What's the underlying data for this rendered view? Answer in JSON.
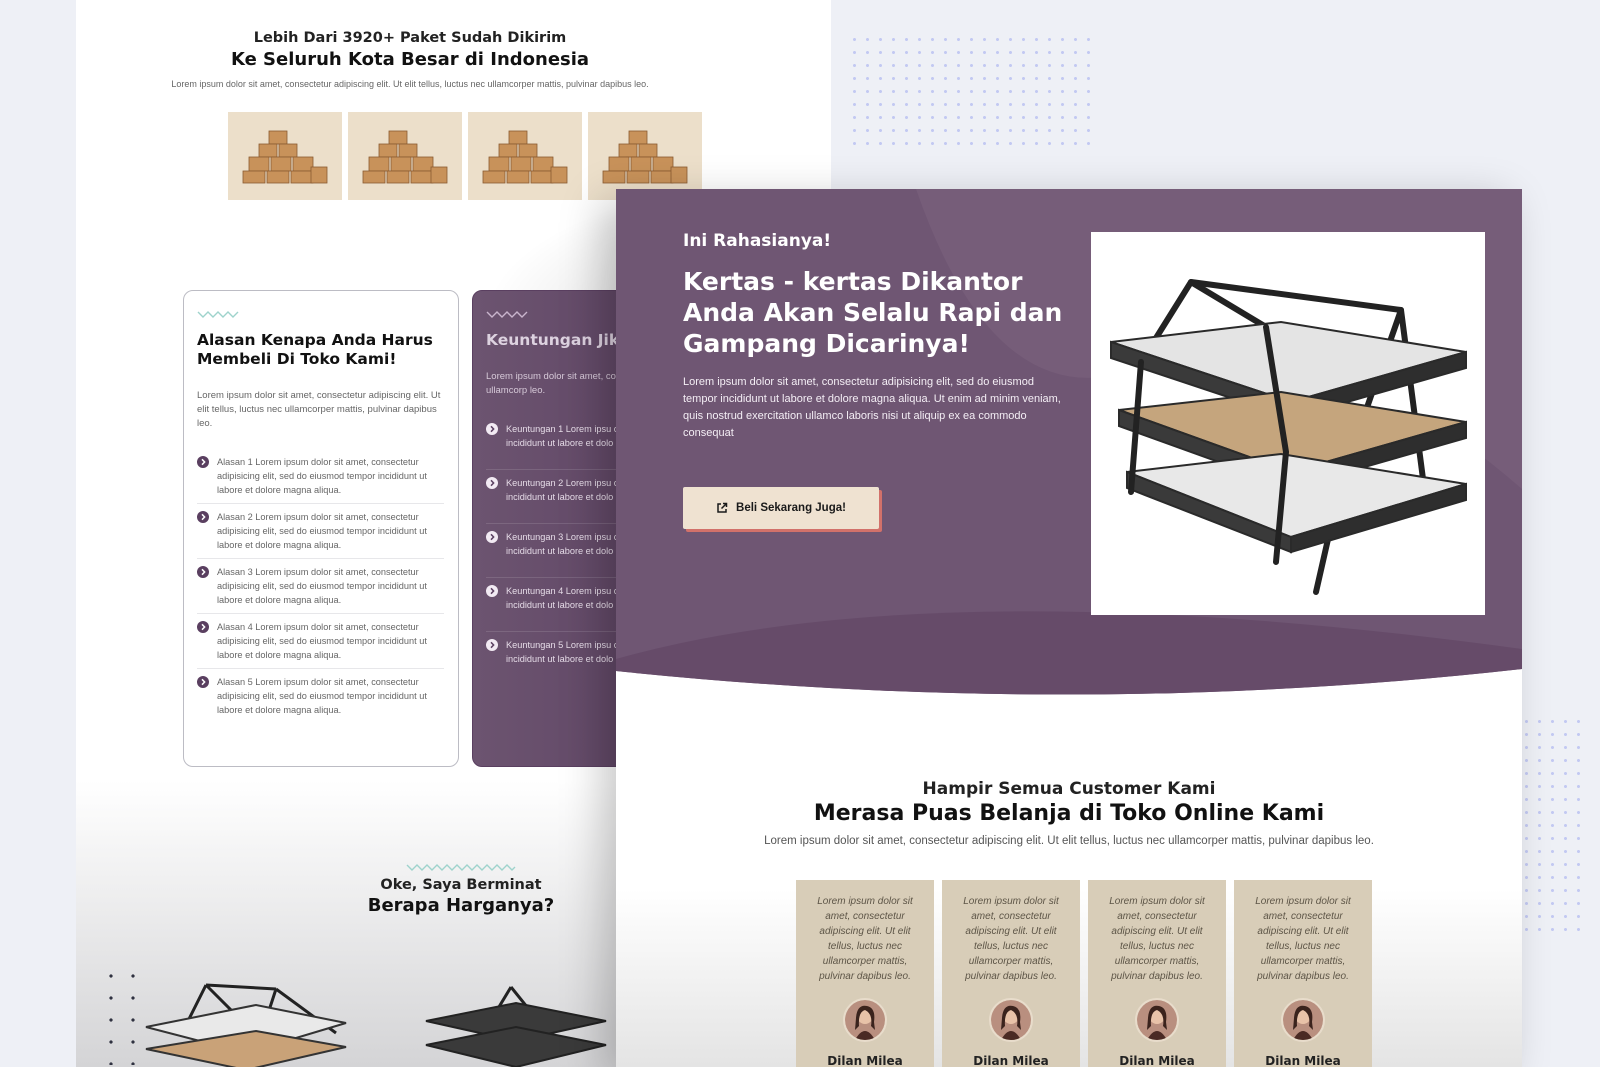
{
  "back_page": {
    "header": {
      "kicker": "Lebih Dari 3920+ Paket Sudah Dikirim",
      "title": "Ke Seluruh Kota Besar di Indonesia",
      "description": "Lorem ipsum dolor sit amet, consectetur adipiscing elit. Ut elit tellus, luctus nec ullamcorper mattis, pulvinar dapibus leo."
    },
    "reasons_card": {
      "title": "Alasan Kenapa Anda Harus Membeli Di Toko Kami!",
      "description": "Lorem ipsum dolor sit amet, consectetur adipiscing elit. Ut elit tellus, luctus nec ullamcorper mattis, pulvinar dapibus leo.",
      "items": [
        "Alasan 1 Lorem ipsum dolor sit amet, consectetur adipisicing elit, sed do eiusmod tempor incididunt ut labore et dolore magna aliqua.",
        "Alasan 2 Lorem ipsum dolor sit amet, consectetur adipisicing elit, sed do eiusmod tempor incididunt ut labore et dolore magna aliqua.",
        "Alasan 3 Lorem ipsum dolor sit amet, consectetur adipisicing elit, sed do eiusmod tempor incididunt ut labore et dolore magna aliqua.",
        "Alasan 4 Lorem ipsum dolor sit amet, consectetur adipisicing elit, sed do eiusmod tempor incididunt ut labore et dolore magna aliqua.",
        "Alasan 5 Lorem ipsum dolor sit amet, consectetur adipisicing elit, sed do eiusmod tempor incididunt ut labore et dolore magna aliqua."
      ]
    },
    "benefits_card": {
      "title": "Keuntungan Jika Sekarang!",
      "description": "Lorem ipsum dolor sit amet, co elit tellus, luctus nec ullamcorp leo.",
      "items": [
        "Keuntungan 1 Lorem ipsu consectetur adipisicing eli incididunt ut labore et dolo",
        "Keuntungan 2 Lorem ipsu consectetur adipisicing eli incididunt ut labore et dolo",
        "Keuntungan 3 Lorem ipsu consectetur adipisicing eli incididunt ut labore et dolo",
        "Keuntungan 4 Lorem ipsu consectetur adipisicing eli incididunt ut labore et dolo",
        "Keuntungan 5 Lorem ipsu consectetur adipisicing eli incididunt ut labore et dolo"
      ]
    },
    "interest": {
      "kicker": "Oke, Saya Berminat",
      "title": "Berapa Harganya?"
    }
  },
  "front_page": {
    "hero": {
      "kicker": "Ini Rahasianya!",
      "title": "Kertas - kertas Dikantor Anda Akan Selalu Rapi dan Gampang Dicarinya!",
      "description": "Lorem ipsum dolor sit amet, consectetur adipisicing elit, sed do eiusmod tempor incididunt ut labore et dolore magna aliqua. Ut enim ad minim veniam, quis nostrud exercitation ullamco laboris nisi ut aliquip ex ea commodo consequat",
      "button_label": "Beli Sekarang Juga!"
    },
    "satisfaction": {
      "kicker": "Hampir Semua Customer Kami",
      "title": "Merasa Puas Belanja di Toko Online Kami",
      "description": "Lorem ipsum dolor sit amet, consectetur adipiscing elit. Ut elit tellus, luctus nec ullamcorper mattis, pulvinar dapibus leo."
    },
    "testimonials": [
      {
        "quote": "Lorem ipsum dolor sit amet, consectetur adipiscing elit. Ut elit tellus, luctus nec ullamcorper mattis, pulvinar dapibus leo.",
        "name": "Dilan Milea"
      },
      {
        "quote": "Lorem ipsum dolor sit amet, consectetur adipiscing elit. Ut elit tellus, luctus nec ullamcorper mattis, pulvinar dapibus leo.",
        "name": "Dilan Milea"
      },
      {
        "quote": "Lorem ipsum dolor sit amet, consectetur adipiscing elit. Ut elit tellus, luctus nec ullamcorper mattis, pulvinar dapibus leo.",
        "name": "Dilan Milea"
      },
      {
        "quote": "Lorem ipsum dolor sit amet, consectetur adipiscing elit. Ut elit tellus, luctus nec ullamcorper mattis, pulvinar dapibus leo.",
        "name": "Dilan Milea"
      }
    ]
  },
  "colors": {
    "brand_purple": "#6f5673",
    "brand_purple_dark": "#5a3f60",
    "cta_background": "#efe2d1",
    "cta_shadow": "#d2716a",
    "testimonial_background": "#d8cdb8",
    "page_background": "#eef0f6"
  },
  "icons": {
    "list_bullet": "chevron-circle-right-icon",
    "cta": "external-link-icon"
  }
}
